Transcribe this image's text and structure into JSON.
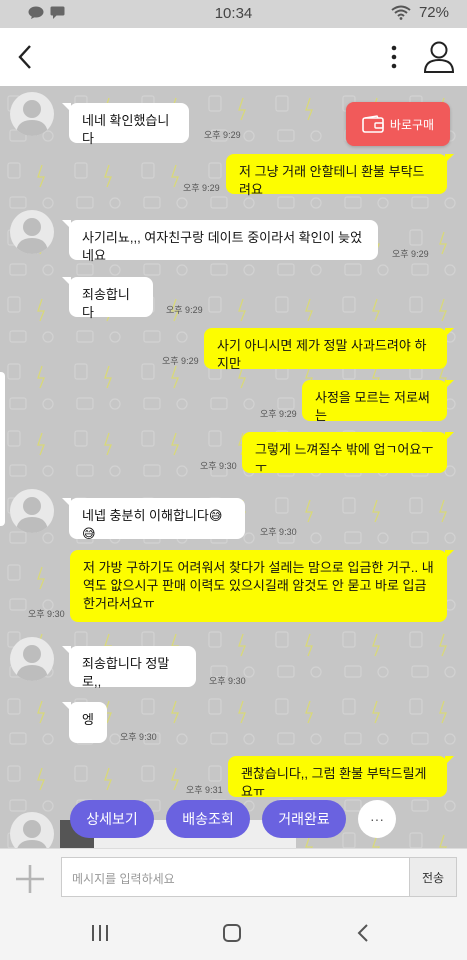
{
  "status_bar": {
    "time": "10:34",
    "battery": "72%"
  },
  "buy_button": {
    "label": "바로구매"
  },
  "messages": [
    {
      "dir": "in",
      "text": "네네 확인했습니다",
      "time": "오후 9:29"
    },
    {
      "dir": "out",
      "text": "저 그냥 거래 안할테니 환불 부탁드려요",
      "time": "오후 9:29"
    },
    {
      "dir": "in",
      "text": "사기리뇨,,, 여자친구랑 데이트 중이라서 확인이 늦었네요",
      "time": "오후 9:29"
    },
    {
      "dir": "in",
      "text": "죄송합니다",
      "time": "오후 9:29"
    },
    {
      "dir": "out",
      "text": "사기 아니시면 제가 정말 사과드려야 하지만",
      "time": "오후 9:29"
    },
    {
      "dir": "out",
      "text": "사정을 모르는 저로써는",
      "time": "오후 9:29"
    },
    {
      "dir": "out",
      "text": "그렇게 느껴질수 밖에 업ㄱ어요ㅜㅜ",
      "time": "오후 9:30"
    },
    {
      "dir": "in",
      "text": "네넵 충분히 이해합니다😅😅",
      "time": "오후 9:30"
    },
    {
      "dir": "out",
      "text": "저 가방 구하기도 어려워서 찾다가 설레는 맘으로 입금한 거구.. 내역도 앖으시구 판매 이력도 있으시길래 암것도 안 묻고 바로 입금한거라서요ㅠ",
      "time": "오후 9:30"
    },
    {
      "dir": "in",
      "text": "죄송합니다 정말로,,",
      "time": "오후 9:30"
    },
    {
      "dir": "in",
      "text": "엥",
      "time": "오후 9:30"
    },
    {
      "dir": "out",
      "text": "괜찮습니다,, 그럼 환불 부탁드릴게요ㅠ",
      "time": "오후 9:31"
    }
  ],
  "quick_actions": [
    "상세보기",
    "배송조회",
    "거래완료",
    "···"
  ],
  "input": {
    "placeholder": "메시지를 입력하세요",
    "send_label": "전송"
  },
  "colors": {
    "incoming_bubble": "#ffffff",
    "outgoing_bubble": "#fdfd00",
    "action_pill": "#6a62e0",
    "buy_button": "#f15a5a"
  }
}
